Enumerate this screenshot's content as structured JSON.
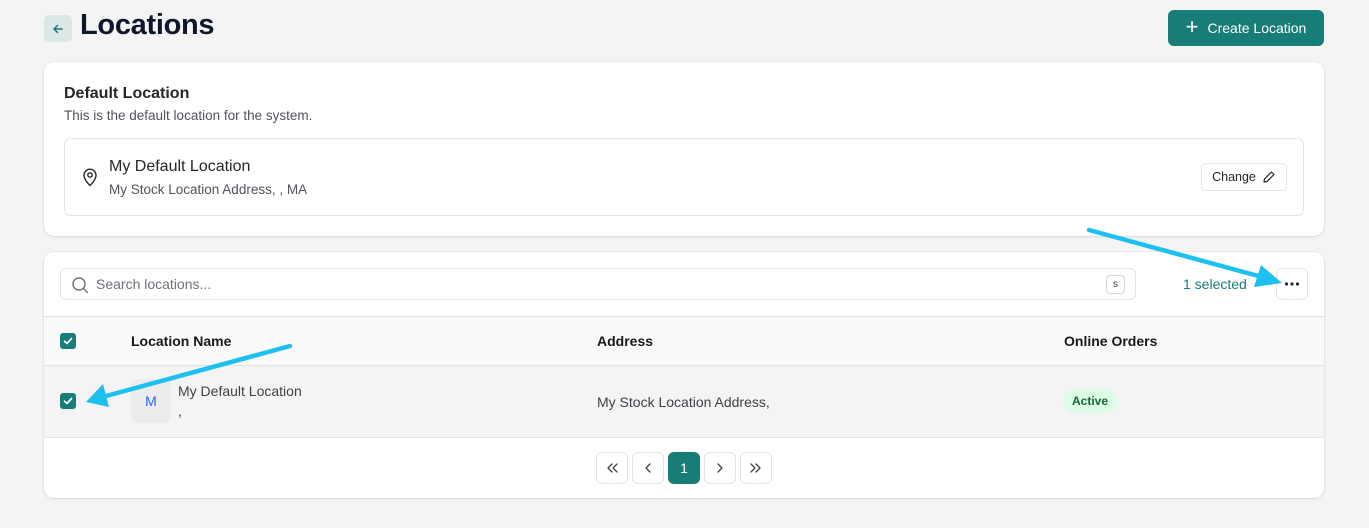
{
  "header": {
    "title": "Locations",
    "create_label": "Create Location"
  },
  "default_location": {
    "title": "Default Location",
    "description": "This is the default location for the system.",
    "name": "My Default Location",
    "address": "My Stock Location Address, , MA",
    "change_label": "Change"
  },
  "toolbar": {
    "search_placeholder": "Search locations...",
    "search_value": "",
    "shortcut_key": "s",
    "selected_text": "1 selected"
  },
  "table": {
    "columns": [
      "Location Name",
      "Address",
      "Online Orders"
    ],
    "rows": [
      {
        "avatar": "M",
        "name": "My Default Location",
        "name_line2": ",",
        "address": "My Stock Location Address,",
        "status": "Active",
        "checked": true
      }
    ],
    "header_checked": true
  },
  "pagination": {
    "current_page": "1"
  },
  "colors": {
    "accent": "#187c77",
    "annotation_arrow": "#1ec0ef",
    "badge_bg": "#dcfce7",
    "badge_text": "#166534"
  },
  "icons": {
    "back": "arrow-left-icon",
    "create": "plus-icon",
    "location": "map-pin-icon",
    "change": "pencil-icon",
    "search": "search-icon",
    "more": "more-horizontal-icon",
    "first": "chevrons-left-icon",
    "prev": "chevron-left-icon",
    "next": "chevron-right-icon",
    "last": "chevrons-right-icon"
  }
}
